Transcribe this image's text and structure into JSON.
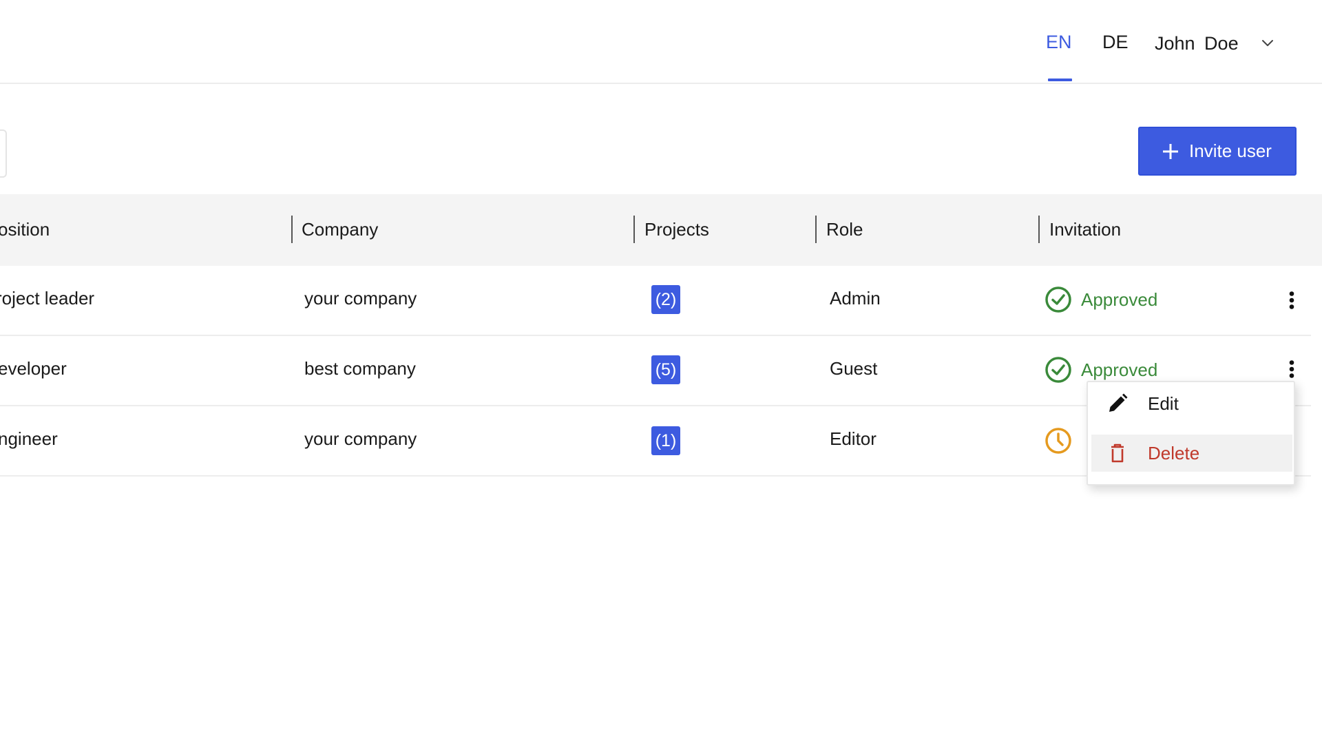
{
  "header": {
    "languages": [
      {
        "code": "EN",
        "active": true
      },
      {
        "code": "DE",
        "active": false
      }
    ],
    "user_name": "John  Doe",
    "user_menu_icon": "chevron-down-icon"
  },
  "toolbar": {
    "invite_label": "Invite user",
    "invite_icon": "plus-icon"
  },
  "table": {
    "columns": [
      "osition",
      "Company",
      "Projects",
      "Role",
      "Invitation"
    ],
    "rows": [
      {
        "position": "roject leader",
        "company": "your company",
        "projects": "(2)",
        "role": "Admin",
        "invitation": "Approved",
        "status": "approved"
      },
      {
        "position": "eveloper",
        "company": "best company",
        "projects": "(5)",
        "role": "Guest",
        "invitation": "Approved",
        "status": "approved"
      },
      {
        "position": "ngineer",
        "company": "your company",
        "projects": "(1)",
        "role": "Editor",
        "invitation": "",
        "status": "pending"
      }
    ]
  },
  "context_menu": {
    "items": [
      {
        "label": "Edit",
        "icon": "pencil-icon"
      },
      {
        "label": "Delete",
        "icon": "trash-icon"
      }
    ]
  },
  "colors": {
    "accent": "#3d5be0",
    "approved": "#3a8a3a",
    "pending": "#e59a1f",
    "danger": "#c0392b"
  }
}
